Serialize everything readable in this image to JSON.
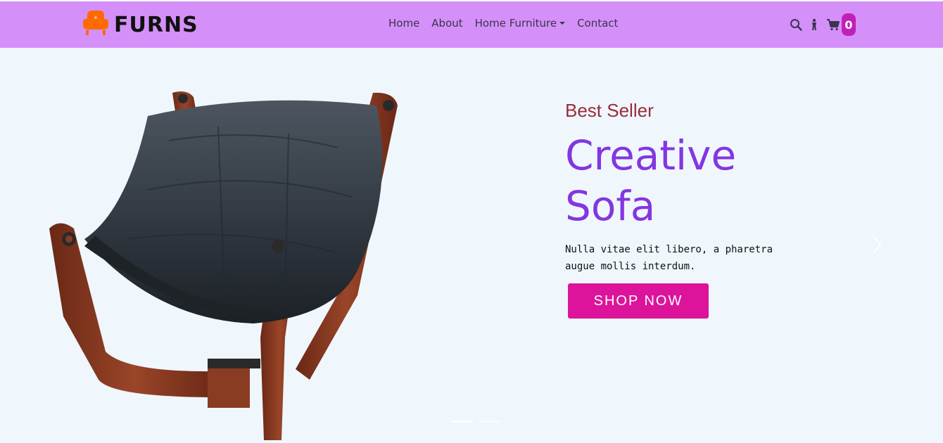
{
  "brand": {
    "name": "FURNS",
    "logo_icon": "armchair-icon",
    "logo_color": "#ff6a00"
  },
  "nav": {
    "links": [
      "Home",
      "About",
      "Home Furniture",
      "Contact"
    ],
    "icons": [
      "search-icon",
      "accessibility-icon",
      "cart-icon"
    ],
    "cart_count": "0"
  },
  "hero": {
    "eyebrow": "Best Seller",
    "headline_line1": "Creative",
    "headline_line2": "Sofa",
    "description": "Nulla vitae elit libero, a pharetra augue mollis interdum.",
    "cta": "SHOP NOW",
    "image_icon": "leather-chair-image"
  },
  "carousel": {
    "slide_count": 2,
    "active_slide": 1,
    "next_icon": "chevron-right-icon"
  },
  "colors": {
    "navbar_bg": "#d490f8",
    "page_bg": "#eff7fd",
    "headline": "#8436e0",
    "eyebrow": "#9b2b3a",
    "cta_bg": "#dc149b",
    "badge_bg": "#c21fb8"
  }
}
